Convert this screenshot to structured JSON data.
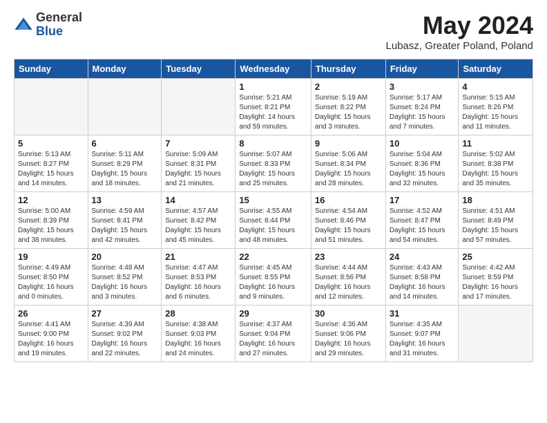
{
  "header": {
    "logo_general": "General",
    "logo_blue": "Blue",
    "title": "May 2024",
    "subtitle": "Lubasz, Greater Poland, Poland"
  },
  "days_of_week": [
    "Sunday",
    "Monday",
    "Tuesday",
    "Wednesday",
    "Thursday",
    "Friday",
    "Saturday"
  ],
  "weeks": [
    [
      {
        "day": "",
        "info": ""
      },
      {
        "day": "",
        "info": ""
      },
      {
        "day": "",
        "info": ""
      },
      {
        "day": "1",
        "info": "Sunrise: 5:21 AM\nSunset: 8:21 PM\nDaylight: 14 hours\nand 59 minutes."
      },
      {
        "day": "2",
        "info": "Sunrise: 5:19 AM\nSunset: 8:22 PM\nDaylight: 15 hours\nand 3 minutes."
      },
      {
        "day": "3",
        "info": "Sunrise: 5:17 AM\nSunset: 8:24 PM\nDaylight: 15 hours\nand 7 minutes."
      },
      {
        "day": "4",
        "info": "Sunrise: 5:15 AM\nSunset: 8:26 PM\nDaylight: 15 hours\nand 11 minutes."
      }
    ],
    [
      {
        "day": "5",
        "info": "Sunrise: 5:13 AM\nSunset: 8:27 PM\nDaylight: 15 hours\nand 14 minutes."
      },
      {
        "day": "6",
        "info": "Sunrise: 5:11 AM\nSunset: 8:29 PM\nDaylight: 15 hours\nand 18 minutes."
      },
      {
        "day": "7",
        "info": "Sunrise: 5:09 AM\nSunset: 8:31 PM\nDaylight: 15 hours\nand 21 minutes."
      },
      {
        "day": "8",
        "info": "Sunrise: 5:07 AM\nSunset: 8:33 PM\nDaylight: 15 hours\nand 25 minutes."
      },
      {
        "day": "9",
        "info": "Sunrise: 5:06 AM\nSunset: 8:34 PM\nDaylight: 15 hours\nand 28 minutes."
      },
      {
        "day": "10",
        "info": "Sunrise: 5:04 AM\nSunset: 8:36 PM\nDaylight: 15 hours\nand 32 minutes."
      },
      {
        "day": "11",
        "info": "Sunrise: 5:02 AM\nSunset: 8:38 PM\nDaylight: 15 hours\nand 35 minutes."
      }
    ],
    [
      {
        "day": "12",
        "info": "Sunrise: 5:00 AM\nSunset: 8:39 PM\nDaylight: 15 hours\nand 38 minutes."
      },
      {
        "day": "13",
        "info": "Sunrise: 4:59 AM\nSunset: 8:41 PM\nDaylight: 15 hours\nand 42 minutes."
      },
      {
        "day": "14",
        "info": "Sunrise: 4:57 AM\nSunset: 8:42 PM\nDaylight: 15 hours\nand 45 minutes."
      },
      {
        "day": "15",
        "info": "Sunrise: 4:55 AM\nSunset: 8:44 PM\nDaylight: 15 hours\nand 48 minutes."
      },
      {
        "day": "16",
        "info": "Sunrise: 4:54 AM\nSunset: 8:46 PM\nDaylight: 15 hours\nand 51 minutes."
      },
      {
        "day": "17",
        "info": "Sunrise: 4:52 AM\nSunset: 8:47 PM\nDaylight: 15 hours\nand 54 minutes."
      },
      {
        "day": "18",
        "info": "Sunrise: 4:51 AM\nSunset: 8:49 PM\nDaylight: 15 hours\nand 57 minutes."
      }
    ],
    [
      {
        "day": "19",
        "info": "Sunrise: 4:49 AM\nSunset: 8:50 PM\nDaylight: 16 hours\nand 0 minutes."
      },
      {
        "day": "20",
        "info": "Sunrise: 4:48 AM\nSunset: 8:52 PM\nDaylight: 16 hours\nand 3 minutes."
      },
      {
        "day": "21",
        "info": "Sunrise: 4:47 AM\nSunset: 8:53 PM\nDaylight: 16 hours\nand 6 minutes."
      },
      {
        "day": "22",
        "info": "Sunrise: 4:45 AM\nSunset: 8:55 PM\nDaylight: 16 hours\nand 9 minutes."
      },
      {
        "day": "23",
        "info": "Sunrise: 4:44 AM\nSunset: 8:56 PM\nDaylight: 16 hours\nand 12 minutes."
      },
      {
        "day": "24",
        "info": "Sunrise: 4:43 AM\nSunset: 8:58 PM\nDaylight: 16 hours\nand 14 minutes."
      },
      {
        "day": "25",
        "info": "Sunrise: 4:42 AM\nSunset: 8:59 PM\nDaylight: 16 hours\nand 17 minutes."
      }
    ],
    [
      {
        "day": "26",
        "info": "Sunrise: 4:41 AM\nSunset: 9:00 PM\nDaylight: 16 hours\nand 19 minutes."
      },
      {
        "day": "27",
        "info": "Sunrise: 4:39 AM\nSunset: 9:02 PM\nDaylight: 16 hours\nand 22 minutes."
      },
      {
        "day": "28",
        "info": "Sunrise: 4:38 AM\nSunset: 9:03 PM\nDaylight: 16 hours\nand 24 minutes."
      },
      {
        "day": "29",
        "info": "Sunrise: 4:37 AM\nSunset: 9:04 PM\nDaylight: 16 hours\nand 27 minutes."
      },
      {
        "day": "30",
        "info": "Sunrise: 4:36 AM\nSunset: 9:06 PM\nDaylight: 16 hours\nand 29 minutes."
      },
      {
        "day": "31",
        "info": "Sunrise: 4:35 AM\nSunset: 9:07 PM\nDaylight: 16 hours\nand 31 minutes."
      },
      {
        "day": "",
        "info": ""
      }
    ]
  ]
}
